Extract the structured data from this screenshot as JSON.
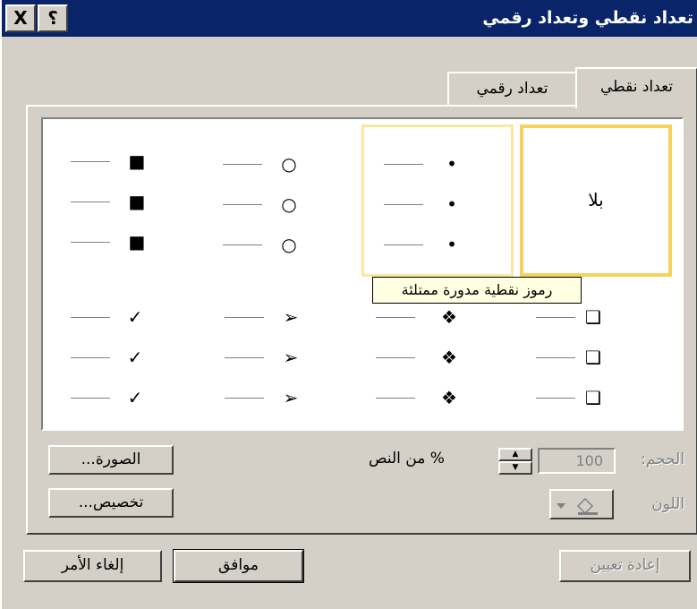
{
  "window": {
    "title": "تعداد نقطي وتعداد رقمي",
    "close_label": "X",
    "help_label": "؟"
  },
  "tabs": [
    {
      "label": "تعداد نقطي",
      "active": true
    },
    {
      "label": "تعداد رقمي",
      "active": false
    }
  ],
  "gallery": {
    "none_label": "بلا",
    "rows": [
      [
        {
          "symbol": "",
          "kind": "none"
        },
        {
          "symbol": "•",
          "kind": "filled-round-bullet"
        },
        {
          "symbol": "○",
          "kind": "hollow-round-bullet"
        },
        {
          "symbol": "■",
          "kind": "filled-square-bullet"
        }
      ],
      [
        {
          "symbol": "❑",
          "kind": "shadowed-box-bullet"
        },
        {
          "symbol": "❖",
          "kind": "four-diamond-bullet"
        },
        {
          "symbol": "➢",
          "kind": "arrowhead-bullet"
        },
        {
          "symbol": "✓",
          "kind": "check-mark-bullet"
        }
      ]
    ],
    "tooltip": "رموز نقطية مدورة ممتلئة"
  },
  "size": {
    "label": "الحجم:",
    "value": "100",
    "suffix": "% من النص"
  },
  "color": {
    "label": "اللون"
  },
  "buttons": {
    "picture": "الصورة...",
    "customize": "تخصيص...",
    "reset": "إعادة تعيين",
    "ok": "موافق",
    "cancel": "إلغاء الأمر"
  },
  "colors": {
    "titlebar": "#0a246a",
    "face": "#d4d0c8",
    "selected_border": "#f7d25b",
    "hover_border": "#fbe79e",
    "tooltip_bg": "#ffffe1"
  }
}
